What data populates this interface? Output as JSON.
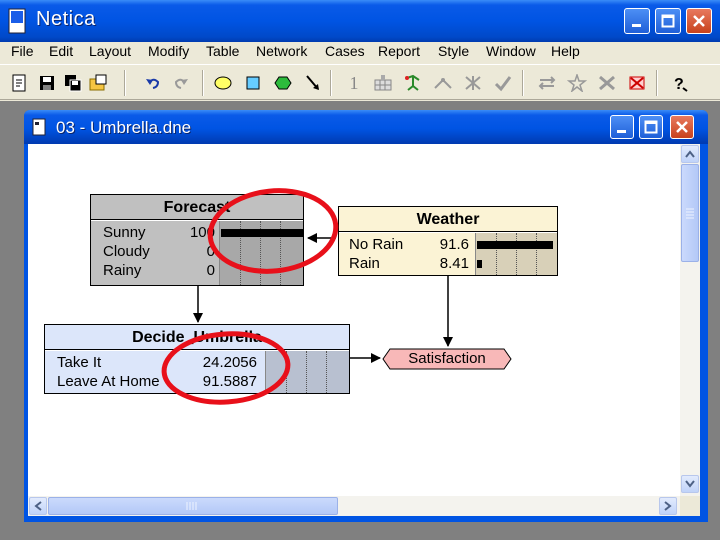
{
  "app": {
    "title": "Netica"
  },
  "menu": [
    "File",
    "Edit",
    "Layout",
    "Modify",
    "Table",
    "Network",
    "Cases",
    "Report",
    "Style",
    "Window",
    "Help"
  ],
  "toolbar": {
    "icons": [
      "new-icon",
      "save-icon",
      "save-all-icon",
      "open-icon",
      "undo-icon",
      "redo-icon",
      "oval-node-icon",
      "rect-node-icon",
      "hexagon-node-icon",
      "arrow-tool-icon",
      "compile-icon",
      "table-icon",
      "run-icon",
      "absorb-icon",
      "reverse-icon",
      "check-icon",
      "equal-icon",
      "star-icon",
      "delete-icon",
      "help-icon"
    ],
    "digit": "1"
  },
  "child": {
    "title": "03 - Umbrella.dne"
  },
  "nodes": {
    "forecast": {
      "title": "Forecast",
      "states": [
        {
          "label": "Sunny",
          "value": "100",
          "belief": 1.0
        },
        {
          "label": "Cloudy",
          "value": "0",
          "belief": 0.0
        },
        {
          "label": "Rainy",
          "value": "0",
          "belief": 0.0
        }
      ]
    },
    "weather": {
      "title": "Weather",
      "states": [
        {
          "label": "No Rain",
          "value": "91.6",
          "belief": 0.916
        },
        {
          "label": "Rain",
          "value": "8.41",
          "belief": 0.0841
        }
      ]
    },
    "decide": {
      "title": "Decide_Umbrella",
      "states": [
        {
          "label": "Take It",
          "value": "24.2056"
        },
        {
          "label": "Leave At Home",
          "value": "91.5887"
        }
      ]
    },
    "satisfaction": {
      "title": "Satisfaction"
    }
  },
  "colors": {
    "forecast_bg": "#c0c0c0",
    "weather_bg": "#fbf3d5",
    "decide_bg": "#dce6fa",
    "satisfaction_bg": "#f8b8b8",
    "highlight_circle": "#e8101a"
  }
}
